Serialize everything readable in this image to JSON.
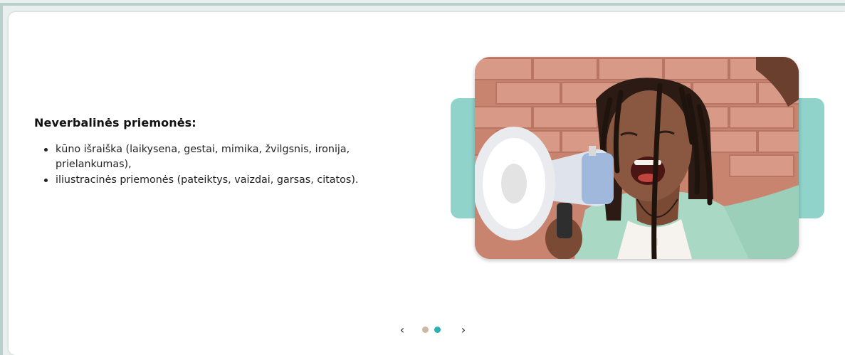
{
  "content": {
    "heading": "Neverbalinės priemonės:",
    "bullets": [
      "kūno išraiška (laikysena, gestai, mimika, žvilgsnis, ironija, prielankumas),",
      "iliustracinės priemonės (pateiktys, vaizdai, garsas, citatos)."
    ]
  },
  "media": {
    "icon": "photo-woman-megaphone"
  },
  "pager": {
    "prev_icon": "chevron-left-icon",
    "next_icon": "chevron-right-icon",
    "prev_glyph": "‹",
    "next_glyph": "›",
    "slides": 2,
    "active_index": 1
  },
  "colors": {
    "accent_teal": "#8fd3cb",
    "dot_inactive": "#cbb9a6",
    "dot_active": "#2ab1ad",
    "text": "#111111"
  }
}
